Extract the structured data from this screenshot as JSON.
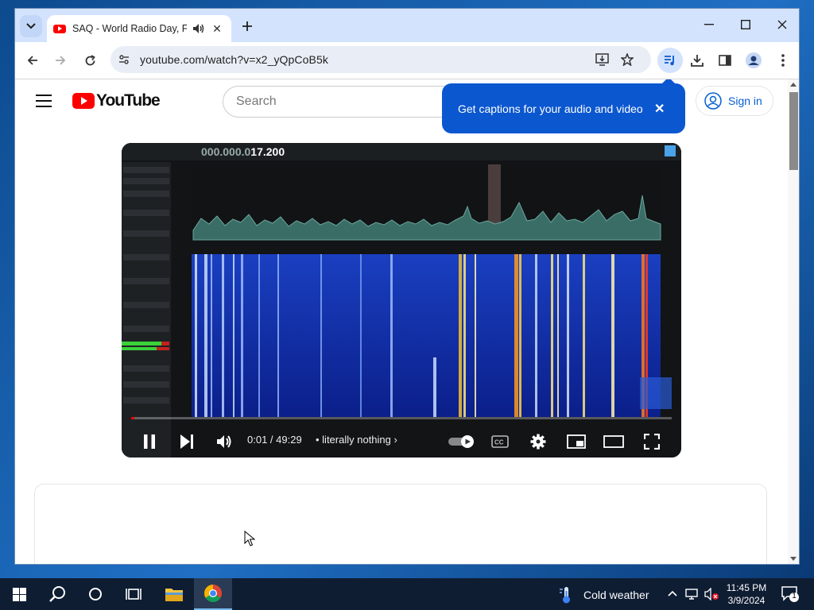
{
  "browser": {
    "tab_title": "SAQ - World Radio Day, Feb",
    "url": "youtube.com/watch?v=x2_yQpCoB5k"
  },
  "youtube": {
    "logo_text": "YouTube",
    "search_placeholder": "Search",
    "sign_in": "Sign in",
    "captions_tip": "Get captions for your audio and video"
  },
  "video": {
    "frequency_dim": "000.000.0",
    "frequency_bright": "17.200",
    "time": "0:01 / 49:29",
    "chapter": "literally nothing",
    "progress_fraction": 0.0003
  },
  "taskbar": {
    "weather": "Cold weather",
    "time": "11:45 PM",
    "date": "3/9/2024",
    "notifications": "1"
  },
  "colors": {
    "brand_red": "#ff0000",
    "accent_blue": "#0b57d0",
    "tabstrip": "#d3e3fd"
  }
}
